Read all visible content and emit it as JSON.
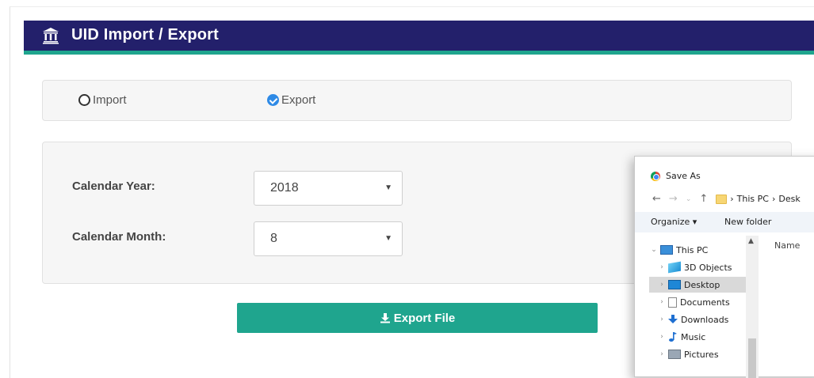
{
  "header": {
    "title": "UID Import / Export",
    "icon": "bank-icon",
    "bar_color": "#23206b",
    "accent_color": "#1fa58e"
  },
  "mode": {
    "options": [
      {
        "label": "Import",
        "checked": false
      },
      {
        "label": "Export",
        "checked": true
      }
    ]
  },
  "form": {
    "year_label": "Calendar Year:",
    "year_value": "2018",
    "month_label": "Calendar Month:",
    "month_value": "8"
  },
  "export_button": {
    "label": "Export File",
    "icon": "download-icon"
  },
  "save_dialog": {
    "title": "Save As",
    "path": [
      "This PC",
      "Desk"
    ],
    "toolbar": {
      "organize": "Organize ▾",
      "new_folder": "New folder"
    },
    "column_name": "Name",
    "tree": [
      {
        "label": "This PC",
        "icon": "computer-icon",
        "expanded": true
      },
      {
        "label": "3D Objects",
        "icon": "cube-icon"
      },
      {
        "label": "Desktop",
        "icon": "desktop-icon",
        "selected": true
      },
      {
        "label": "Documents",
        "icon": "document-icon"
      },
      {
        "label": "Downloads",
        "icon": "download-arrow-icon"
      },
      {
        "label": "Music",
        "icon": "music-note-icon"
      },
      {
        "label": "Pictures",
        "icon": "picture-icon"
      }
    ]
  }
}
